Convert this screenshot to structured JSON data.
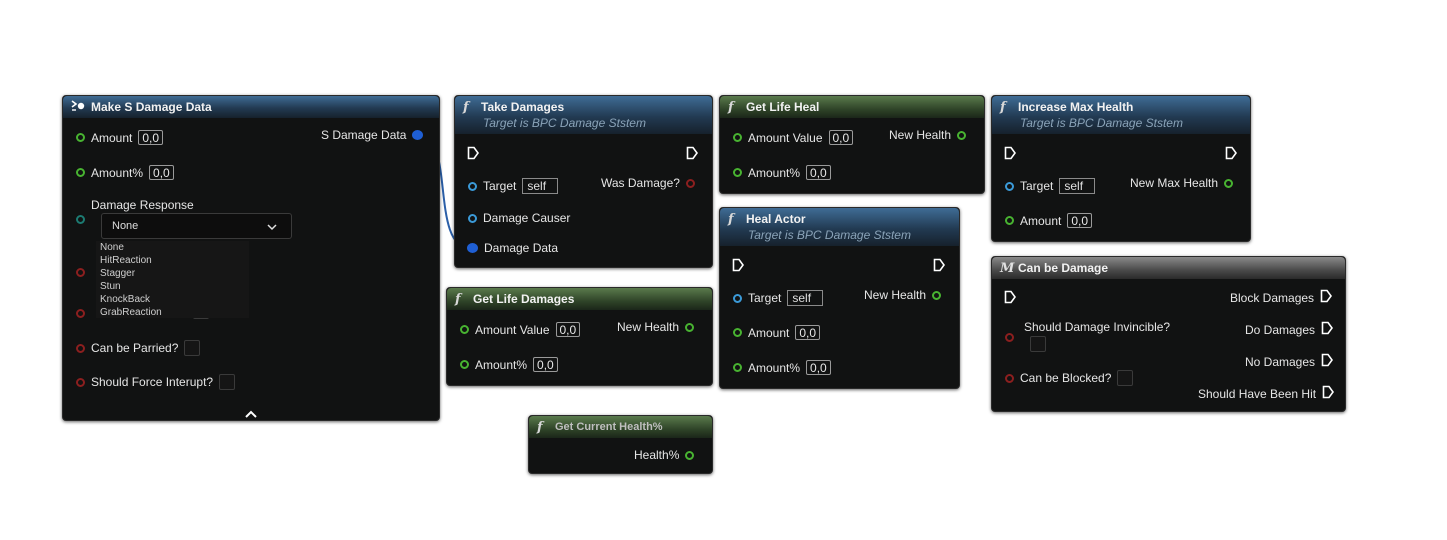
{
  "make_s_damage_data": {
    "title": "Make S Damage Data",
    "amount_label": "Amount",
    "amount_value": "0,0",
    "amount_pct_label": "Amount%",
    "amount_pct_value": "0,0",
    "damage_response_label": "Damage Response",
    "damage_response_selected": "None",
    "damage_response_options": [
      "None",
      "HitReaction",
      "Stagger",
      "Stun",
      "KnockBack",
      "GrabReaction"
    ],
    "can_be_parried_label": "Can be Parried?",
    "should_force_interupt_label": "Should Force Interupt?",
    "output_label": "S Damage Data"
  },
  "take_damages": {
    "title": "Take Damages",
    "subtitle": "Target is BPC Damage Ststem",
    "target_label": "Target",
    "target_value": "self",
    "was_damage_label": "Was Damage?",
    "damage_causer_label": "Damage Causer",
    "damage_data_label": "Damage Data"
  },
  "get_life_damages": {
    "title": "Get Life Damages",
    "amount_value_label": "Amount Value",
    "amount_value_value": "0,0",
    "amount_pct_label": "Amount%",
    "amount_pct_value": "0,0",
    "new_health_label": "New Health"
  },
  "get_current_health": {
    "title": "Get Current Health%",
    "output_label": "Health%"
  },
  "get_life_heal": {
    "title": "Get Life Heal",
    "amount_value_label": "Amount Value",
    "amount_value_value": "0,0",
    "amount_pct_label": "Amount%",
    "amount_pct_value": "0,0",
    "new_health_label": "New Health"
  },
  "heal_actor": {
    "title": "Heal Actor",
    "subtitle": "Target is BPC Damage Ststem",
    "target_label": "Target",
    "target_value": "self",
    "amount_label": "Amount",
    "amount_value": "0,0",
    "amount_pct_label": "Amount%",
    "amount_pct_value": "0,0",
    "new_health_label": "New Health"
  },
  "increase_max_health": {
    "title": "Increase Max Health",
    "subtitle": "Target is BPC Damage Ststem",
    "target_label": "Target",
    "target_value": "self",
    "amount_label": "Amount",
    "amount_value": "0,0",
    "new_max_health_label": "New Max Health"
  },
  "can_be_damage": {
    "title": "Can be Damage",
    "should_damage_invincible_label": "Should Damage Invincible?",
    "can_be_blocked_label": "Can be Blocked?",
    "block_damages_label": "Block Damages",
    "do_damages_label": "Do Damages",
    "no_damages_label": "No Damages",
    "should_have_been_hit_label": "Should Have Been Hit"
  },
  "colors": {
    "float_pin": "#48b331",
    "object_pin": "#3b9ad8",
    "struct_pin": "#1f5fd4",
    "bool_pin": "#8c1f1f",
    "enum_pin": "#1c7b72",
    "function_header": "#3f6c95",
    "pure_header": "#5a7a4c",
    "macro_header": "#8a8a8a"
  }
}
